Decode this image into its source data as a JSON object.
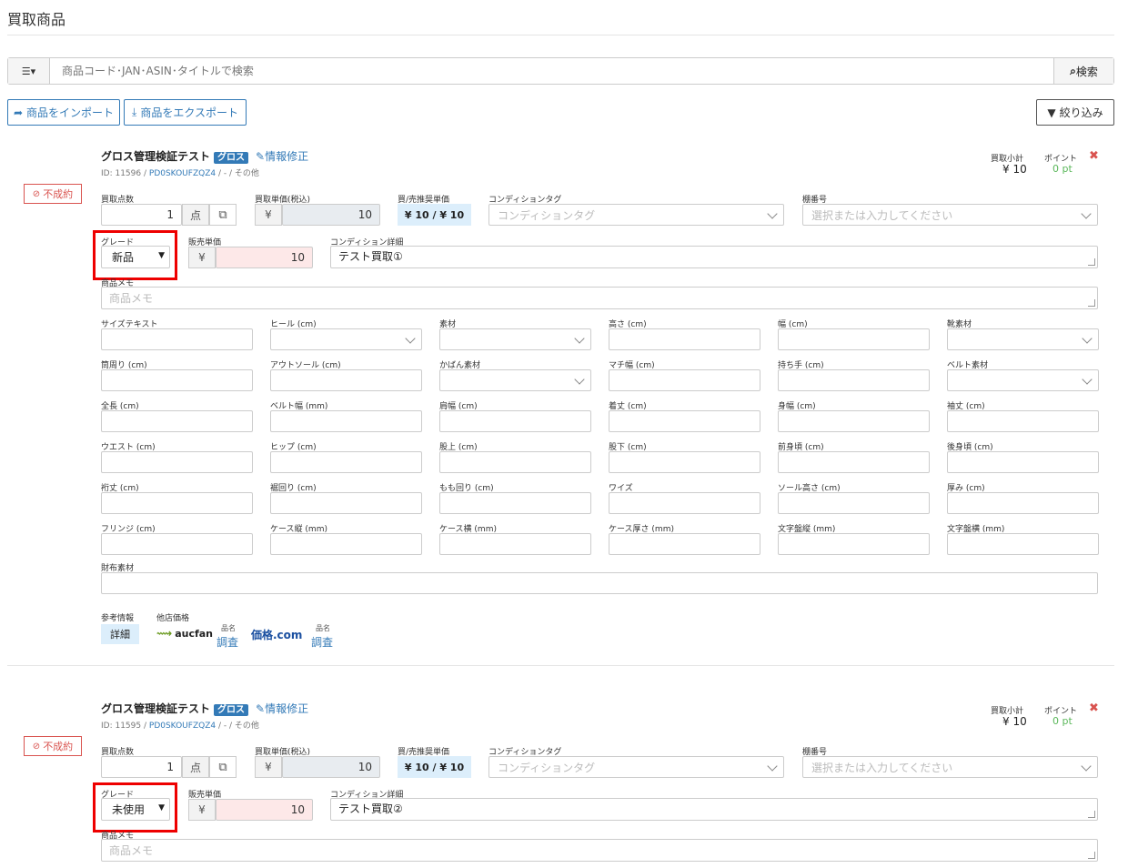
{
  "page": {
    "title": "買取商品"
  },
  "search": {
    "placeholder": "商品コード･JAN･ASIN･タイトルで検索",
    "button": "検索"
  },
  "toolbar": {
    "import": "商品をインポート",
    "export": "商品をエクスポート",
    "filter": "絞り込み"
  },
  "labels": {
    "qty": "買取点数",
    "qty_unit": "点",
    "price": "買取単価(税込)",
    "buy_sell": "買/売推奨単価",
    "cond_tag": "コンディションタグ",
    "shelf": "棚番号",
    "grade": "グレード",
    "sale_price": "販売単価",
    "cond_detail": "コンディション詳細",
    "memo": "商品メモ",
    "subtotal": "買取小計",
    "point": "ポイント",
    "yen": "¥",
    "status": "不成約",
    "gross": "グロス",
    "edit": "情報修正",
    "cond_tag_ph": "コンディションタグ",
    "shelf_ph": "選択または入力してください",
    "memo_ph": "商品メモ",
    "ref": "参考情報",
    "other_price": "他店価格",
    "detail": "詳細",
    "aucfan": "aucfan",
    "kakaku": "価格.com",
    "hinmei": "品名",
    "chousa": "調査",
    "zaifu": "財布素材"
  },
  "spec_rows": [
    [
      "サイズテキスト",
      "ヒール (cm)",
      "素材",
      "高さ (cm)",
      "幅 (cm)",
      "靴素材"
    ],
    [
      "筒周り (cm)",
      "アウトソール (cm)",
      "かばん素材",
      "マチ幅 (cm)",
      "持ち手 (cm)",
      "ベルト素材"
    ],
    [
      "全長 (cm)",
      "ベルト幅 (mm)",
      "肩幅 (cm)",
      "着丈 (cm)",
      "身幅 (cm)",
      "袖丈 (cm)"
    ],
    [
      "ウエスト (cm)",
      "ヒップ (cm)",
      "股上 (cm)",
      "股下 (cm)",
      "前身頃 (cm)",
      "後身頃 (cm)"
    ],
    [
      "裄丈 (cm)",
      "裾回り (cm)",
      "もも回り (cm)",
      "ワイズ",
      "ソール高さ (cm)",
      "厚み (cm)"
    ],
    [
      "フリンジ (cm)",
      "ケース縦 (mm)",
      "ケース横 (mm)",
      "ケース厚さ (mm)",
      "文字盤縦 (mm)",
      "文字盤横 (mm)"
    ]
  ],
  "items": [
    {
      "name": "グロス管理検証テスト",
      "id": "ID: 11596 /",
      "code": "PD0SKOUFZQZ4",
      "meta_tail": "/ - / その他",
      "subtotal": "¥ 10",
      "point": "0 pt",
      "qty": "1",
      "price": "10",
      "buy_sell": "¥ 10 / ¥ 10",
      "grade": "新品",
      "sale_price": "10",
      "cond_detail": "テスト買取①"
    },
    {
      "name": "グロス管理検証テスト",
      "id": "ID: 11595 /",
      "code": "PD0SKOUFZQZ4",
      "meta_tail": "/ - / その他",
      "subtotal": "¥ 10",
      "point": "0 pt",
      "qty": "1",
      "price": "10",
      "buy_sell": "¥ 10 / ¥ 10",
      "grade": "未使用",
      "sale_price": "10",
      "cond_detail": "テスト買取②"
    }
  ],
  "colors": {
    "accent": "#337ab7",
    "danger": "#d9534f",
    "highlight": "#e00000",
    "success": "#5cb85c"
  }
}
